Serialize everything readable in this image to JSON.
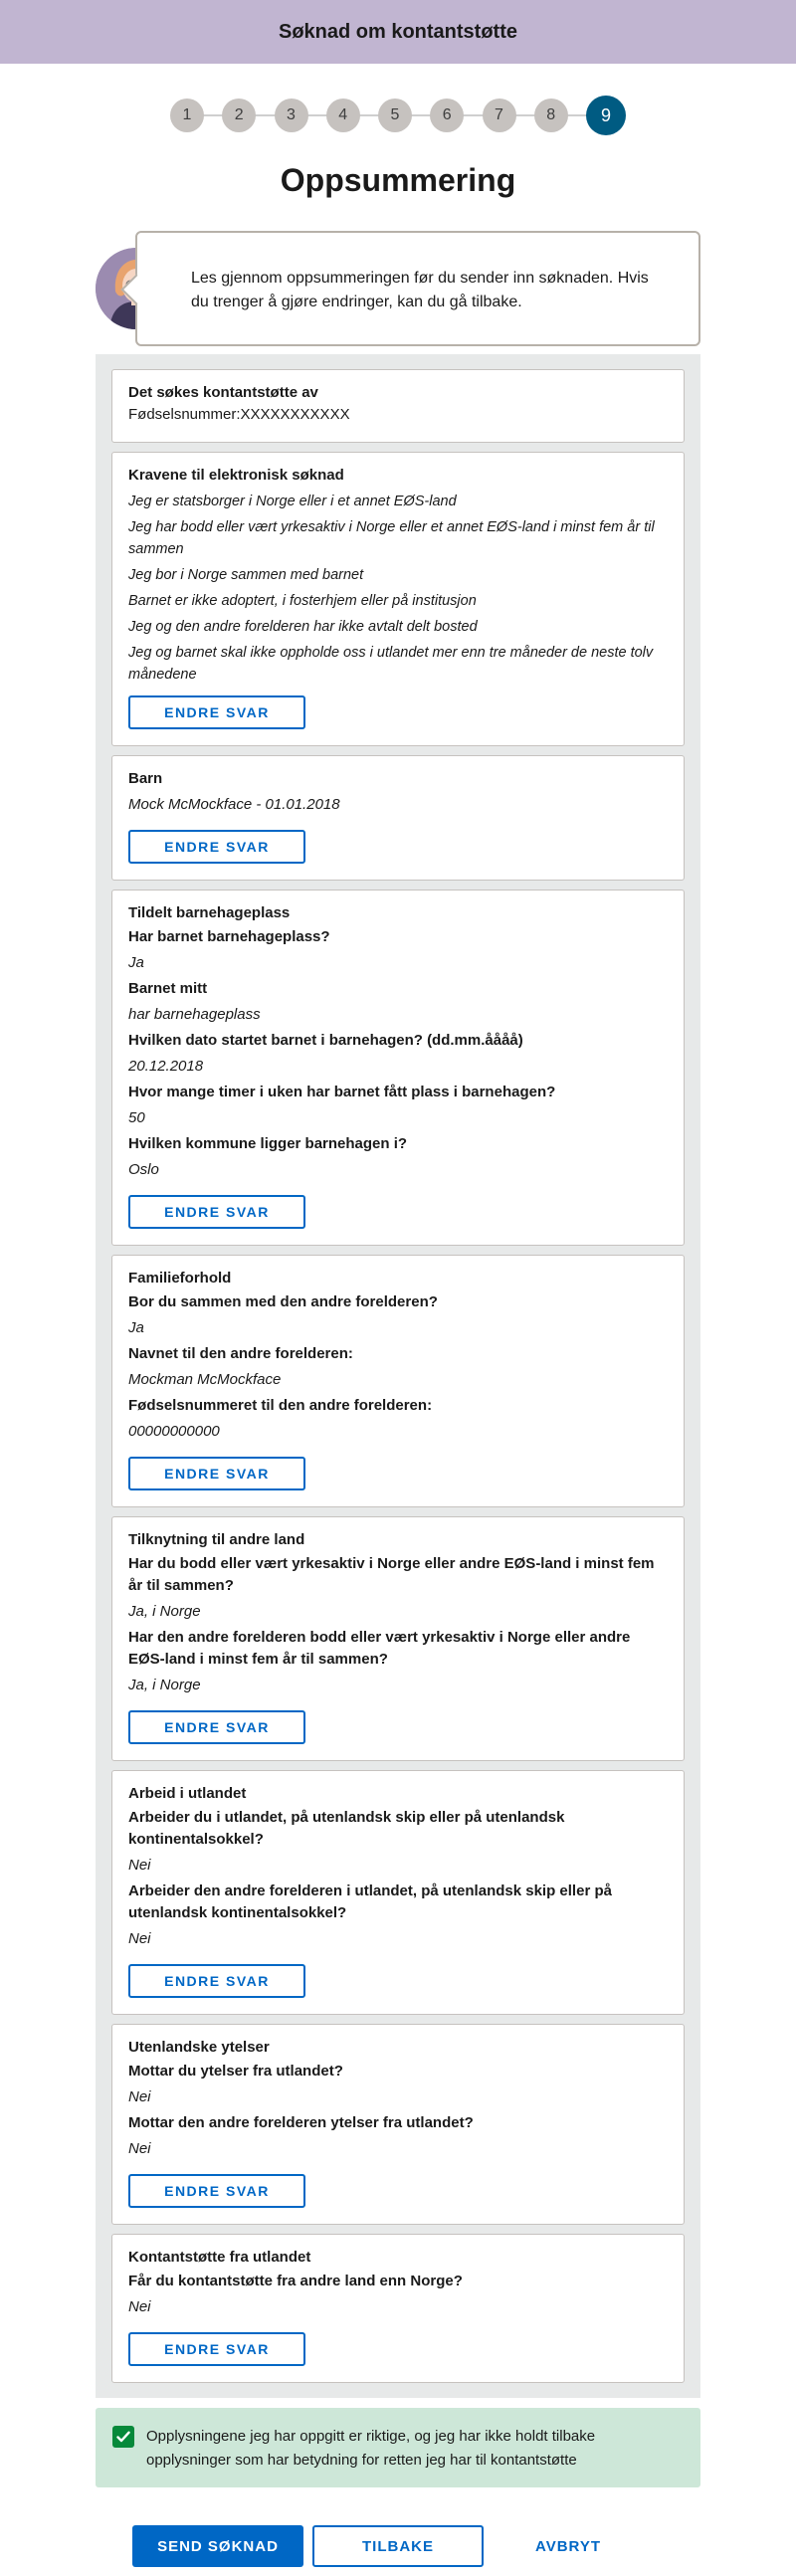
{
  "header": {
    "title": "Søknad om kontantstøtte"
  },
  "stepper": {
    "steps": [
      "1",
      "2",
      "3",
      "4",
      "5",
      "6",
      "7",
      "8",
      "9"
    ],
    "active": 9
  },
  "page_title": "Oppsummering",
  "intro": {
    "text": "Les gjennom oppsummeringen før du sender inn søknaden. Hvis du trenger å gjøre endringer, kan du gå tilbake."
  },
  "applicant": {
    "title": "Det søkes kontantstøtte av",
    "id_text": "Fødselsnummer:XXXXXXXXXXX"
  },
  "edit_label": "ENDRE SVAR",
  "requirements": {
    "title": "Kravene til elektronisk søknad",
    "items": [
      "Jeg er statsborger i Norge eller i et annet EØS-land",
      "Jeg har bodd eller vært yrkesaktiv i Norge eller et annet EØS-land i minst fem år til sammen",
      "Jeg bor i Norge sammen med barnet",
      "Barnet er ikke adoptert, i fosterhjem eller på institusjon",
      "Jeg og den andre forelderen har ikke avtalt delt bosted",
      "Jeg og barnet skal ikke oppholde oss i utlandet mer enn tre måneder de neste tolv månedene"
    ]
  },
  "child": {
    "title": "Barn",
    "value": "Mock McMockface - 01.01.2018"
  },
  "kindergarten": {
    "title": "Tildelt barnehageplass",
    "qa": [
      {
        "q": "Har barnet barnehageplass?",
        "a": "Ja"
      },
      {
        "q": "Barnet mitt",
        "a": "har barnehageplass"
      },
      {
        "q": "Hvilken dato startet barnet i barnehagen? (dd.mm.åååå)",
        "a": "20.12.2018"
      },
      {
        "q": "Hvor mange timer i uken har barnet fått plass i barnehagen?",
        "a": "50"
      },
      {
        "q": "Hvilken kommune ligger barnehagen i?",
        "a": "Oslo"
      }
    ]
  },
  "family": {
    "title": "Familieforhold",
    "qa": [
      {
        "q": "Bor du sammen med den andre forelderen?",
        "a": "Ja"
      },
      {
        "q": "Navnet til den andre forelderen:",
        "a": "Mockman McMockface"
      },
      {
        "q": "Fødselsnummeret til den andre forelderen:",
        "a": "00000000000"
      }
    ]
  },
  "connection": {
    "title": "Tilknytning til andre land",
    "qa": [
      {
        "q": "Har du bodd eller vært yrkesaktiv i Norge eller andre EØS-land i minst fem år til sammen?",
        "a": "Ja, i Norge"
      },
      {
        "q": "Har den andre forelderen bodd eller vært yrkesaktiv i Norge eller andre EØS-land i minst fem år til sammen?",
        "a": "Ja, i Norge"
      }
    ]
  },
  "work_abroad": {
    "title": "Arbeid i utlandet",
    "qa": [
      {
        "q": "Arbeider du i utlandet, på utenlandsk skip eller på utenlandsk kontinentalsokkel?",
        "a": "Nei"
      },
      {
        "q": "Arbeider den andre forelderen i utlandet, på utenlandsk skip eller på utenlandsk kontinentalsokkel?",
        "a": "Nei"
      }
    ]
  },
  "foreign_benefits": {
    "title": "Utenlandske ytelser",
    "qa": [
      {
        "q": "Mottar du ytelser fra utlandet?",
        "a": "Nei"
      },
      {
        "q": "Mottar den andre forelderen ytelser fra utlandet?",
        "a": "Nei"
      }
    ]
  },
  "foreign_support": {
    "title": "Kontantstøtte fra utlandet",
    "qa": [
      {
        "q": "Får du kontantstøtte fra andre land enn Norge?",
        "a": "Nei"
      }
    ]
  },
  "confirmation": {
    "text": "Opplysningene jeg har oppgitt er riktige, og jeg har ikke holdt tilbake opplysninger som har betydning for retten jeg har til kontantstøtte",
    "checked": true
  },
  "actions": {
    "send": "SEND SØKNAD",
    "back": "TILBAKE",
    "cancel": "AVBRYT"
  },
  "colors": {
    "header_bg": "#c1b5d1",
    "primary": "#0067c5",
    "active_step": "#005b82",
    "confirm_bg": "#cde7d8",
    "check": "#06893a"
  }
}
